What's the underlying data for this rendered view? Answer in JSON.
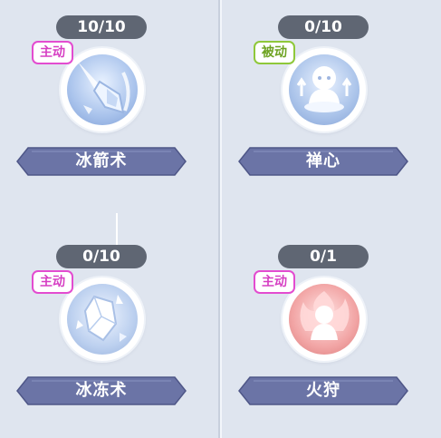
{
  "colors": {
    "background": "#dfe5ef",
    "level_pill": "#5f6673",
    "name_banner": "#6b74a6",
    "active_tag": "#d63fc3",
    "passive_tag": "#6ea322"
  },
  "skills": [
    {
      "level": "10/10",
      "tag": "主动",
      "tag_type": "active",
      "name": "冰箭术",
      "icon": "ice-arrow-icon"
    },
    {
      "level": "0/10",
      "tag": "被动",
      "tag_type": "passive",
      "name": "禅心",
      "icon": "meditation-icon"
    },
    {
      "level": "0/10",
      "tag": "主动",
      "tag_type": "active",
      "name": "冰冻术",
      "icon": "ice-crystal-icon"
    },
    {
      "level": "0/1",
      "tag": "主动",
      "tag_type": "active",
      "name": "火狩",
      "icon": "fire-spirit-icon"
    }
  ]
}
